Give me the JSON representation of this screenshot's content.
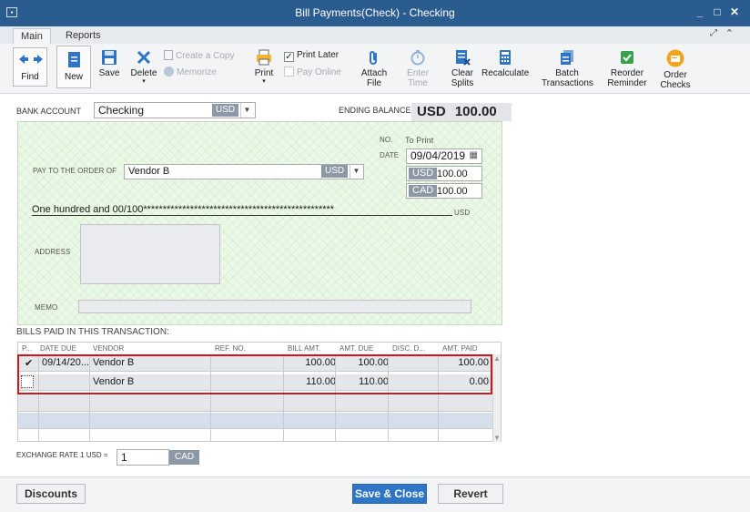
{
  "window": {
    "title": "Bill Payments(Check) - Checking",
    "controls": [
      "minimize",
      "maximize",
      "close"
    ]
  },
  "tabs": [
    {
      "label": "Main",
      "active": true
    },
    {
      "label": "Reports",
      "active": false
    }
  ],
  "toolbar": {
    "find": "Find",
    "new": "New",
    "save": "Save",
    "delete": "Delete",
    "create_copy": "Create a Copy",
    "memorize": "Memorize",
    "print": "Print",
    "print_later": "Print Later",
    "print_later_checked": true,
    "pay_online": "Pay Online",
    "attach_file_line1": "Attach",
    "attach_file_line2": "File",
    "enter_time_line1": "Enter",
    "enter_time_line2": "Time",
    "clear_splits_line1": "Clear",
    "clear_splits_line2": "Splits",
    "recalculate": "Recalculate",
    "batch_line1": "Batch",
    "batch_line2": "Transactions",
    "reorder_line1": "Reorder",
    "reorder_line2": "Reminder",
    "order_checks_line1": "Order",
    "order_checks_line2": "Checks"
  },
  "bank": {
    "label": "BANK ACCOUNT",
    "account": "Checking",
    "currency": "USD",
    "ending_balance_label": "ENDING BALANCE",
    "ending_balance_currency": "USD",
    "ending_balance": "100.00"
  },
  "check": {
    "no_label": "NO.",
    "no_value": "To Print",
    "date_label": "DATE",
    "date": "09/04/2019",
    "payee_label": "PAY TO THE ORDER OF",
    "payee": "Vendor B",
    "payee_currency": "USD",
    "amount_usd_label": "USD",
    "amount_usd": "100.00",
    "amount_cad_label": "CAD",
    "amount_cad": "100.00",
    "amount_words": "One hundred and 00/100*************************************************",
    "amount_words_currency": "USD",
    "address_label": "ADDRESS",
    "address": "",
    "memo_label": "MEMO",
    "memo": ""
  },
  "bills": {
    "section_label": "BILLS PAID IN THIS TRANSACTION:",
    "columns": [
      "P...",
      "DATE DUE",
      "VENDOR",
      "REF. NO.",
      "BILL AMT.",
      "AMT. DUE",
      "DISC. D...",
      "AMT. PAID"
    ],
    "rows": [
      {
        "paid": true,
        "date_due": "09/14/20...",
        "vendor": "Vendor B",
        "ref_no": "",
        "bill_amt": "100.00",
        "amt_due": "100.00",
        "disc": "",
        "amt_paid": "100.00"
      },
      {
        "paid": false,
        "date_due": "",
        "vendor": "Vendor B",
        "ref_no": "",
        "bill_amt": "110.00",
        "amt_due": "110.00",
        "disc": "",
        "amt_paid": "0.00"
      }
    ]
  },
  "exchange": {
    "label": "EXCHANGE RATE 1 USD =",
    "value": "1",
    "currency": "CAD"
  },
  "buttons": {
    "discounts": "Discounts",
    "save_close": "Save & Close",
    "revert": "Revert"
  },
  "colors": {
    "titlebar": "#2b5c8f",
    "primary_button": "#2e74c7",
    "highlight": "#d4141a",
    "check_background": "#ebf8e7"
  }
}
